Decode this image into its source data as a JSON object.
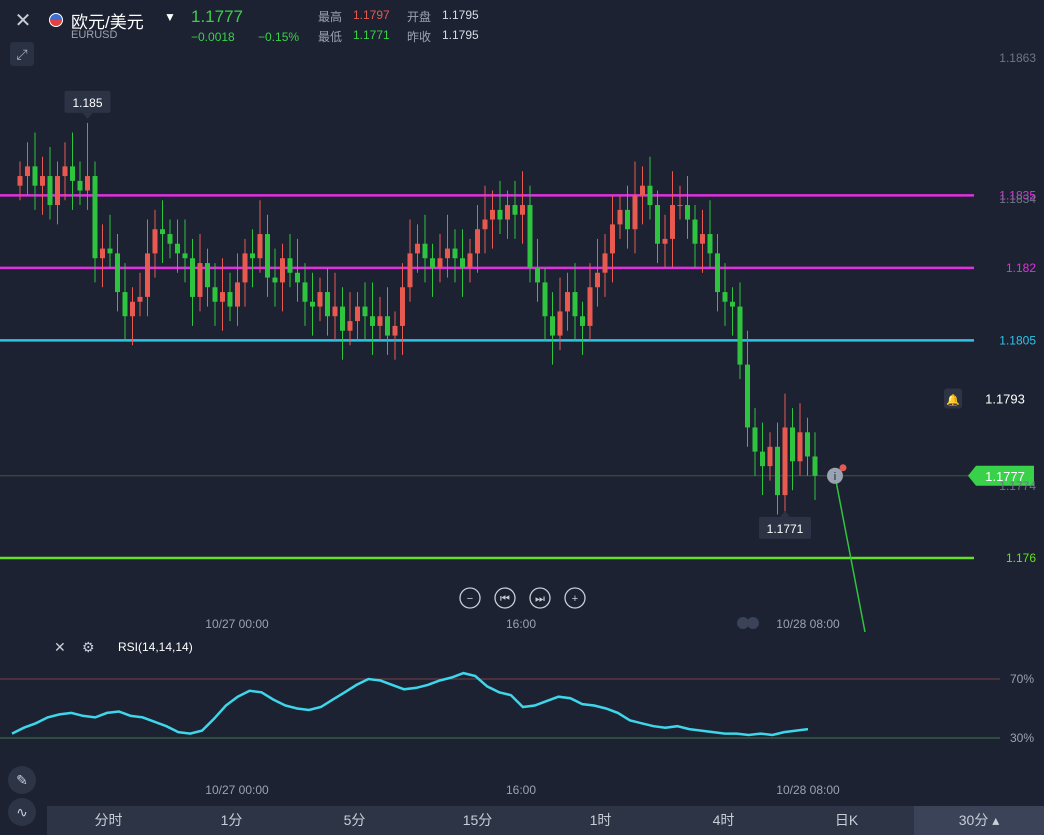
{
  "header": {
    "pair_name": "欧元/美元",
    "pair_code": "EURUSD",
    "last_price": "1.1777",
    "change": "−0.0018",
    "change_pct": "−0.15%",
    "high_label": "最高",
    "high_value": "1.1797",
    "open_label": "开盘",
    "open_value": "1.1795",
    "low_label": "最低",
    "low_value": "1.1771",
    "prev_label": "昨收",
    "prev_value": "1.1795"
  },
  "colors": {
    "background": "#1c2231",
    "up": "#e8594f",
    "down": "#2fc43f",
    "magenta_line": "#e030e0",
    "cyan_line": "#2ec4e8",
    "green_line": "#66e022",
    "rsi_line": "#3ed6ea",
    "current_price_tag": "#3ad14a"
  },
  "chart_data": [
    {
      "type": "candlestick",
      "title": "",
      "ylim": [
        1.1755,
        1.1868
      ],
      "right_axis_labels": [
        "1.1863",
        "1.1834",
        "1.1774"
      ],
      "x_tick_labels": [
        "10/27 00:00",
        "16:00",
        "10/28 08:00"
      ],
      "horizontal_lines": [
        {
          "value": 1.1835,
          "label": "1.1835",
          "color": "#e030e0"
        },
        {
          "value": 1.182,
          "label": "1.182",
          "color": "#e030e0"
        },
        {
          "value": 1.1805,
          "label": "1.1805",
          "color": "#2ec4e8"
        },
        {
          "value": 1.176,
          "label": "1.176",
          "color": "#66e022"
        }
      ],
      "price_tags": [
        {
          "value": 1.1793,
          "label": "1.1793",
          "kind": "alert"
        },
        {
          "value": 1.1777,
          "label": "1.1777",
          "kind": "current"
        }
      ],
      "annotations": [
        {
          "label": "1.185",
          "value": 1.185,
          "at": "high"
        },
        {
          "label": "1.1771",
          "value": 1.1771,
          "at": "low"
        }
      ],
      "close": [
        1.1839,
        1.1841,
        1.1837,
        1.1839,
        1.1833,
        1.1839,
        1.1841,
        1.1838,
        1.1836,
        1.1839,
        1.1822,
        1.1824,
        1.1823,
        1.1815,
        1.181,
        1.1813,
        1.1814,
        1.1823,
        1.1828,
        1.1827,
        1.1825,
        1.1823,
        1.1822,
        1.1814,
        1.1821,
        1.1816,
        1.1813,
        1.1815,
        1.1812,
        1.1817,
        1.1823,
        1.1822,
        1.1827,
        1.1818,
        1.1817,
        1.1822,
        1.1819,
        1.1817,
        1.1813,
        1.1812,
        1.1815,
        1.181,
        1.1812,
        1.1807,
        1.1809,
        1.1812,
        1.181,
        1.1808,
        1.181,
        1.1806,
        1.1808,
        1.1816,
        1.1823,
        1.1825,
        1.1822,
        1.182,
        1.1822,
        1.1824,
        1.1822,
        1.182,
        1.1823,
        1.1828,
        1.183,
        1.1832,
        1.183,
        1.1833,
        1.1831,
        1.1833,
        1.182,
        1.1817,
        1.181,
        1.1806,
        1.1811,
        1.1815,
        1.181,
        1.1808,
        1.1816,
        1.1819,
        1.1823,
        1.1829,
        1.1832,
        1.1828,
        1.1835,
        1.1837,
        1.1833,
        1.1825,
        1.1826,
        1.1833,
        1.1833,
        1.183,
        1.1825,
        1.1827,
        1.1823,
        1.1815,
        1.1813,
        1.1812,
        1.18,
        1.1787,
        1.1782,
        1.1779,
        1.1783,
        1.1773,
        1.1787,
        1.178,
        1.1786,
        1.1781,
        1.1777
      ]
    },
    {
      "type": "line",
      "title": "RSI(14,14,14)",
      "ylim": [
        0,
        100
      ],
      "y_tick_labels": [
        "70%",
        "30%"
      ],
      "reference_lines": [
        70,
        30
      ],
      "x_tick_labels": [
        "10/27 00:00",
        "16:00",
        "10/28 08:00"
      ],
      "series": [
        {
          "name": "RSI(14,14,14)",
          "values": [
            33,
            37,
            40,
            44,
            46,
            47,
            45,
            44,
            47,
            48,
            45,
            44,
            41,
            38,
            34,
            33,
            35,
            43,
            52,
            58,
            62,
            61,
            56,
            52,
            50,
            49,
            51,
            56,
            61,
            66,
            70,
            69,
            66,
            63,
            64,
            66,
            69,
            71,
            74,
            72,
            65,
            61,
            59,
            51,
            52,
            55,
            58,
            57,
            53,
            52,
            50,
            47,
            42,
            40,
            38,
            37,
            38,
            36,
            35,
            34,
            33,
            33,
            32,
            33,
            32,
            34,
            35,
            36
          ]
        }
      ]
    }
  ],
  "controls": {
    "zoom_out": "−",
    "prev": "⏮",
    "next": "⏭",
    "zoom_in": "+"
  },
  "timeframes": [
    "分时",
    "1分",
    "5分",
    "15分",
    "1时",
    "4时",
    "日K",
    "30分"
  ],
  "active_timeframe": "30分"
}
